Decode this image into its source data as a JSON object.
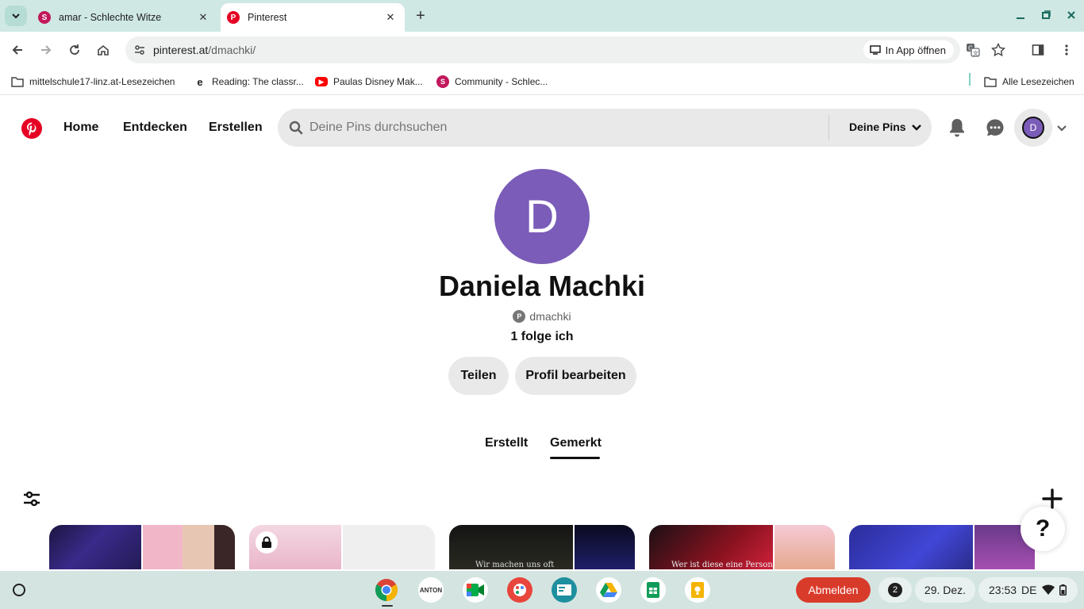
{
  "browser": {
    "tabs": [
      {
        "title": "amar - Schlechte Witze",
        "favicon_color": "#c2185b",
        "favicon_letter": "S",
        "active": false
      },
      {
        "title": "Pinterest",
        "favicon_color": "#e60023",
        "favicon_letter": "P",
        "active": true
      }
    ],
    "url_host": "pinterest.at",
    "url_path": "/dmachki/",
    "in_app_label": "In App öffnen",
    "bookmarks": [
      {
        "label": "mittelschule17-linz.at-Lesezeichen",
        "icon": "folder-icon"
      },
      {
        "label": "Reading: The classr...",
        "icon": "e-icon"
      },
      {
        "label": "Paulas Disney Mak...",
        "icon": "youtube-icon"
      },
      {
        "label": "Community - Schlec...",
        "icon": "s-icon"
      }
    ],
    "all_bookmarks_label": "Alle Lesezeichen"
  },
  "pinterest": {
    "nav": {
      "home": "Home",
      "explore": "Entdecken",
      "create": "Erstellen"
    },
    "search_placeholder": "Deine Pins durchsuchen",
    "pins_dropdown": "Deine Pins",
    "avatar_letter": "D",
    "profile": {
      "initial": "D",
      "name": "Daniela Machki",
      "handle": "dmachki",
      "following": "1 folge ich",
      "share_label": "Teilen",
      "edit_label": "Profil bearbeiten"
    },
    "tabs": {
      "created": "Erstellt",
      "saved": "Gemerkt"
    },
    "help": "?",
    "board_captions": {
      "b3": "Wir machen uns oft",
      "b4": "Wer ist diese eine Person"
    },
    "brand_color": "#e60023",
    "avatar_color": "#7b5cb8"
  },
  "shelf": {
    "apps": [
      "chrome-icon",
      "anton-icon",
      "meet-icon",
      "canvas-icon",
      "classroom-icon",
      "drive-icon",
      "sheets-icon",
      "keep-icon"
    ],
    "anton_label": "ANTON",
    "logout_label": "Abmelden",
    "notification_count": "2",
    "date": "29. Dez.",
    "time": "23:53",
    "lang": "DE"
  }
}
